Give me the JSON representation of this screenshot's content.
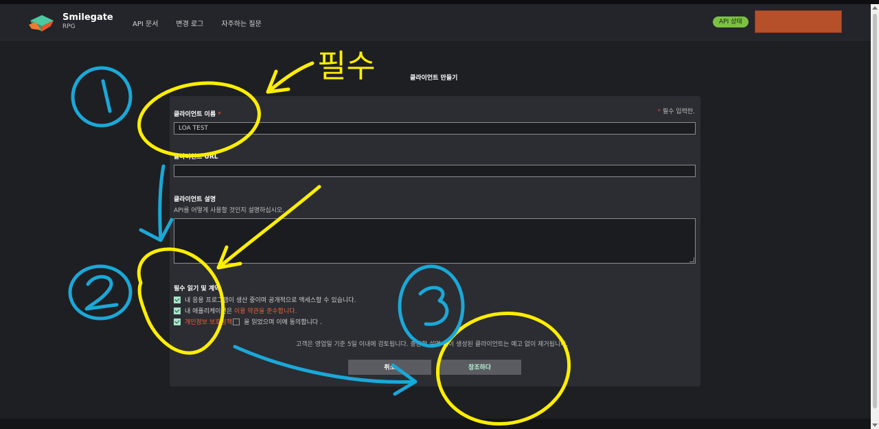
{
  "header": {
    "brand_name": "Smilegate",
    "brand_sub": "RPG",
    "nav": [
      "API 문서",
      "변경 로그",
      "자주하는 질문"
    ],
    "api_status": "API 상태"
  },
  "page": {
    "title": "클라이언트 만들기",
    "required_note": "필수 입력란.",
    "star": "*"
  },
  "form": {
    "name_label": "클라이언트 이름",
    "name_value": "LOA TEST",
    "url_label": "클라이언트 URL",
    "url_value": "",
    "desc_label": "클라이언트 설명",
    "desc_hint": "API를 어떻게 사용할 것인지 설명하십시오.",
    "desc_value": "",
    "agreement_title": "필수 읽기 및 계약",
    "agreements": {
      "a1": "내 응용 프로그램이 생산 중이며 공개적으로 액세스할 수 있습니다.",
      "a2_prefix": "내 애플리케이션은",
      "a2_link": "이용 약관을 준수합니다.",
      "a3_link": "개인정보 보호정책",
      "a3_suffix": "을 읽었으며 이에 동의합니다 ."
    },
    "notice": "고객은 영업일 기준 5일 이내에 검토됩니다. 충분한 설명 없이 생성된 클라이언트는 예고 없이 제거됩니다.",
    "cancel_label": "취소",
    "submit_label": "창조하다"
  },
  "annotations": {
    "required_text": "필수"
  },
  "colors": {
    "annotation_yellow": "#ffee00",
    "annotation_blue": "#1aa8d8",
    "accent_red": "#f0603e",
    "status_green": "#7bc043"
  }
}
